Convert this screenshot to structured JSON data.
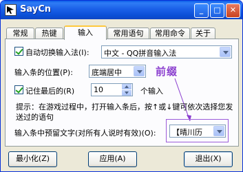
{
  "window": {
    "title": "SayCn"
  },
  "titlebar_buttons": {
    "minimize": "_",
    "maximize": "□",
    "close": "✕"
  },
  "tabs": [
    {
      "label": "常规",
      "active": false
    },
    {
      "label": "热键",
      "active": false
    },
    {
      "label": "输入",
      "active": true
    },
    {
      "label": "常用语句",
      "active": false
    },
    {
      "label": "常用命令",
      "active": false
    },
    {
      "label": "关于",
      "active": false
    }
  ],
  "input": {
    "auto_switch": {
      "label": "自动切换输入法(I):",
      "checked": true,
      "value": "中文 - QQ拼音输入法"
    },
    "position": {
      "label": "输入条的位置(P):",
      "value": "底端居中"
    },
    "remember": {
      "label": "记住最后的(R)",
      "checked": true,
      "value": "10",
      "suffix": "个输入"
    },
    "hint": "提示：在游戏过程中，打开输入条后，按↑或↓键可依次选择您发送过的语句",
    "prefix": {
      "label": "输入条中预留文字(对所有人说时有效)(O):",
      "value": "【晴川历"
    }
  },
  "annotation": {
    "text": "前缀",
    "color": "#8b3fcf"
  },
  "buttons": {
    "minimize": "最小化(Z)",
    "apply": "应用(A)",
    "exit": "退出(X)"
  }
}
